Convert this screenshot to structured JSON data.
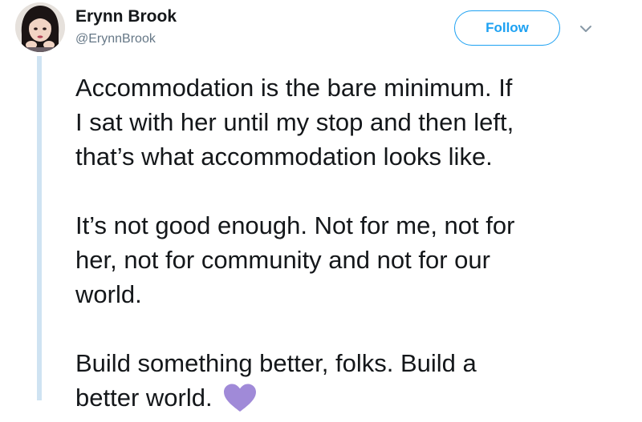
{
  "author": {
    "name": "Erynn Brook",
    "handle": "@ErynnBrook",
    "avatar_icon": "profile-photo"
  },
  "actions": {
    "follow_label": "Follow",
    "more_icon": "chevron-down-icon"
  },
  "tweet": {
    "paragraphs": [
      "Accommodation is the bare minimum. If\nI sat with her until my stop and then left,\nthat’s what accommodation looks like.",
      "It’s not good enough. Not for me, not for\nher, not for community and not for our\nworld.",
      "Build something better, folks. Build a\nbetter world."
    ],
    "emoji": "purple-heart"
  },
  "colors": {
    "accent": "#1da1f2",
    "handle": "#657786",
    "text": "#14171a",
    "thread_line": "#cfe3f2",
    "heart": "#a08ad8"
  }
}
